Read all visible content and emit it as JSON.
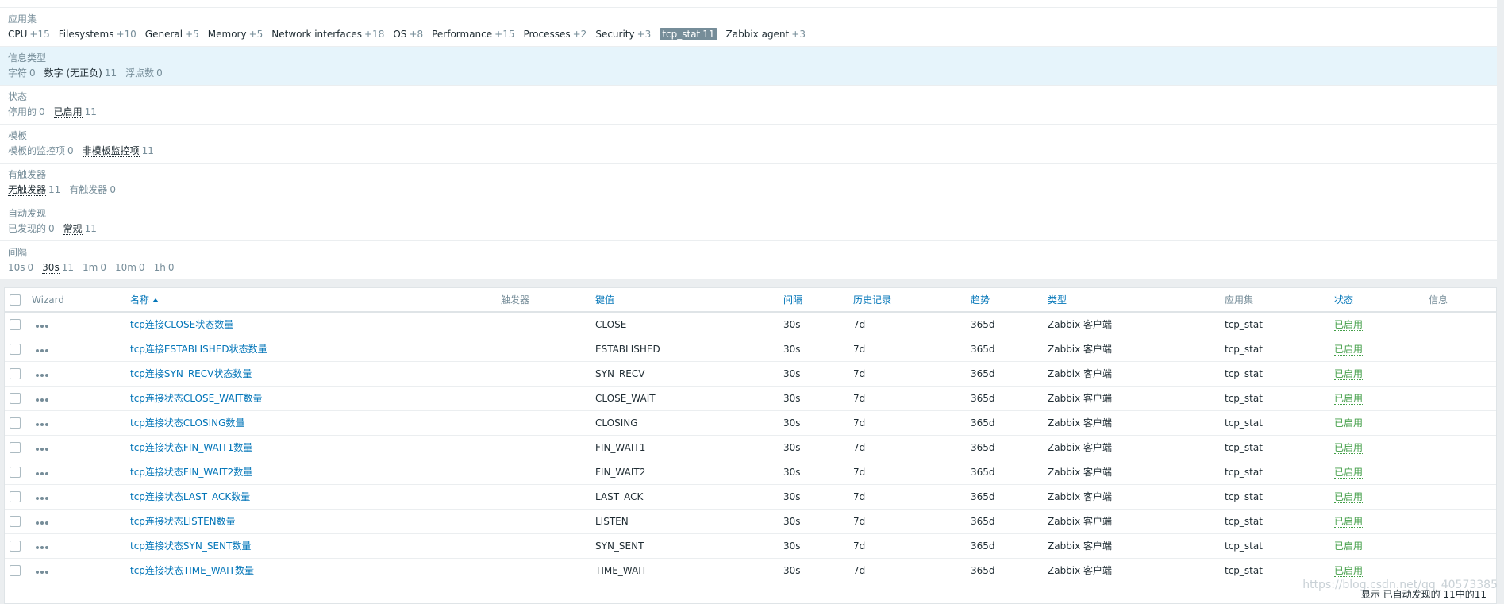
{
  "facets": [
    {
      "title": "应用集",
      "selected": false,
      "values": [
        {
          "label": "CPU",
          "count": "+15",
          "style": "link"
        },
        {
          "label": "Filesystems",
          "count": "+10",
          "style": "link"
        },
        {
          "label": "General",
          "count": "+5",
          "style": "link"
        },
        {
          "label": "Memory",
          "count": "+5",
          "style": "link"
        },
        {
          "label": "Network interfaces",
          "count": "+18",
          "style": "link"
        },
        {
          "label": "OS",
          "count": "+8",
          "style": "link"
        },
        {
          "label": "Performance",
          "count": "+15",
          "style": "link"
        },
        {
          "label": "Processes",
          "count": "+2",
          "style": "link"
        },
        {
          "label": "Security",
          "count": "+3",
          "style": "link"
        },
        {
          "label": "tcp_stat",
          "count": "11",
          "style": "active"
        },
        {
          "label": "Zabbix agent",
          "count": "+3",
          "style": "link"
        }
      ]
    },
    {
      "title": "信息类型",
      "selected": true,
      "values": [
        {
          "label": "字符",
          "count": "0",
          "style": "plain"
        },
        {
          "label": "数字 (无正负)",
          "count": "11",
          "style": "link"
        },
        {
          "label": "浮点数",
          "count": "0",
          "style": "plain"
        }
      ]
    },
    {
      "title": "状态",
      "selected": false,
      "values": [
        {
          "label": "停用的",
          "count": "0",
          "style": "plain"
        },
        {
          "label": "已启用",
          "count": "11",
          "style": "link"
        }
      ]
    },
    {
      "title": "模板",
      "selected": false,
      "values": [
        {
          "label": "模板的监控项",
          "count": "0",
          "style": "plain"
        },
        {
          "label": "非模板监控项",
          "count": "11",
          "style": "link"
        }
      ]
    },
    {
      "title": "有触发器",
      "selected": false,
      "values": [
        {
          "label": "无触发器",
          "count": "11",
          "style": "link"
        },
        {
          "label": "有触发器",
          "count": "0",
          "style": "plain"
        }
      ]
    },
    {
      "title": "自动发现",
      "selected": false,
      "values": [
        {
          "label": "已发现的",
          "count": "0",
          "style": "plain"
        },
        {
          "label": "常规",
          "count": "11",
          "style": "link"
        }
      ]
    },
    {
      "title": "间隔",
      "selected": false,
      "values": [
        {
          "label": "10s",
          "count": "0",
          "style": "plain"
        },
        {
          "label": "30s",
          "count": "11",
          "style": "link"
        },
        {
          "label": "1m",
          "count": "0",
          "style": "plain"
        },
        {
          "label": "10m",
          "count": "0",
          "style": "plain"
        },
        {
          "label": "1h",
          "count": "0",
          "style": "plain"
        }
      ]
    }
  ],
  "table": {
    "columns": {
      "wizard": "Wizard",
      "name": "名称",
      "triggers": "触发器",
      "key": "键值",
      "interval": "间隔",
      "history": "历史记录",
      "trends": "趋势",
      "type": "类型",
      "applications": "应用集",
      "status": "状态",
      "info": "信息"
    },
    "rows": [
      {
        "name": "tcp连接CLOSE状态数量",
        "key": "CLOSE",
        "interval": "30s",
        "history": "7d",
        "trends": "365d",
        "type": "Zabbix 客户端",
        "app": "tcp_stat",
        "status": "已启用"
      },
      {
        "name": "tcp连接ESTABLISHED状态数量",
        "key": "ESTABLISHED",
        "interval": "30s",
        "history": "7d",
        "trends": "365d",
        "type": "Zabbix 客户端",
        "app": "tcp_stat",
        "status": "已启用"
      },
      {
        "name": "tcp连接SYN_RECV状态数量",
        "key": "SYN_RECV",
        "interval": "30s",
        "history": "7d",
        "trends": "365d",
        "type": "Zabbix 客户端",
        "app": "tcp_stat",
        "status": "已启用"
      },
      {
        "name": "tcp连接状态CLOSE_WAIT数量",
        "key": "CLOSE_WAIT",
        "interval": "30s",
        "history": "7d",
        "trends": "365d",
        "type": "Zabbix 客户端",
        "app": "tcp_stat",
        "status": "已启用"
      },
      {
        "name": "tcp连接状态CLOSING数量",
        "key": "CLOSING",
        "interval": "30s",
        "history": "7d",
        "trends": "365d",
        "type": "Zabbix 客户端",
        "app": "tcp_stat",
        "status": "已启用"
      },
      {
        "name": "tcp连接状态FIN_WAIT1数量",
        "key": "FIN_WAIT1",
        "interval": "30s",
        "history": "7d",
        "trends": "365d",
        "type": "Zabbix 客户端",
        "app": "tcp_stat",
        "status": "已启用"
      },
      {
        "name": "tcp连接状态FIN_WAIT2数量",
        "key": "FIN_WAIT2",
        "interval": "30s",
        "history": "7d",
        "trends": "365d",
        "type": "Zabbix 客户端",
        "app": "tcp_stat",
        "status": "已启用"
      },
      {
        "name": "tcp连接状态LAST_ACK数量",
        "key": "LAST_ACK",
        "interval": "30s",
        "history": "7d",
        "trends": "365d",
        "type": "Zabbix 客户端",
        "app": "tcp_stat",
        "status": "已启用"
      },
      {
        "name": "tcp连接状态LISTEN数量",
        "key": "LISTEN",
        "interval": "30s",
        "history": "7d",
        "trends": "365d",
        "type": "Zabbix 客户端",
        "app": "tcp_stat",
        "status": "已启用"
      },
      {
        "name": "tcp连接状态SYN_SENT数量",
        "key": "SYN_SENT",
        "interval": "30s",
        "history": "7d",
        "trends": "365d",
        "type": "Zabbix 客户端",
        "app": "tcp_stat",
        "status": "已启用"
      },
      {
        "name": "tcp连接状态TIME_WAIT数量",
        "key": "TIME_WAIT",
        "interval": "30s",
        "history": "7d",
        "trends": "365d",
        "type": "Zabbix 客户端",
        "app": "tcp_stat",
        "status": "已启用"
      }
    ]
  },
  "footer": {
    "summary": "显示 已自动发现的 11中的11"
  },
  "watermark": "https://blog.csdn.net/qq_40573385",
  "colors": {
    "link": "#0275b8",
    "status_enabled": "#429e47",
    "muted": "#768d99",
    "selected_facet_bg": "#e6f4fb"
  }
}
